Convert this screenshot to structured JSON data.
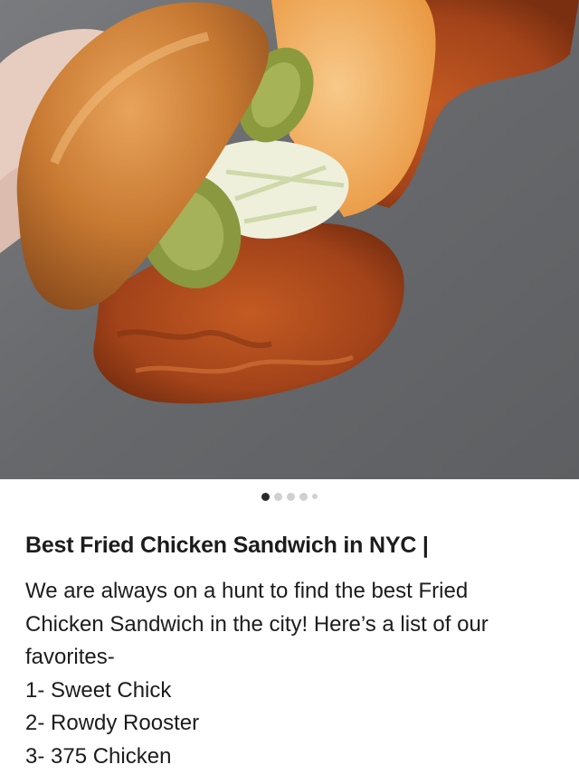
{
  "post": {
    "title": "Best Fried Chicken Sandwich in NYC |",
    "body_lines": [
      "We are always on a hunt to find the best Fried",
      "Chicken Sandwich in the city! Here’s a list of our",
      "favorites-",
      "1- Sweet Chick",
      "2- Rowdy Rooster",
      "3- 375 Chicken"
    ]
  },
  "carousel": {
    "total_slides": 5,
    "active_index": 1,
    "image_subject": "hand holding a fried chicken sandwich with pickles, slaw and orange sauce"
  },
  "colors": {
    "background": "#ffffff",
    "text": "#1c1c1c",
    "dot_active": "#2a2a2a",
    "dot_inactive": "#d0d0d0"
  }
}
